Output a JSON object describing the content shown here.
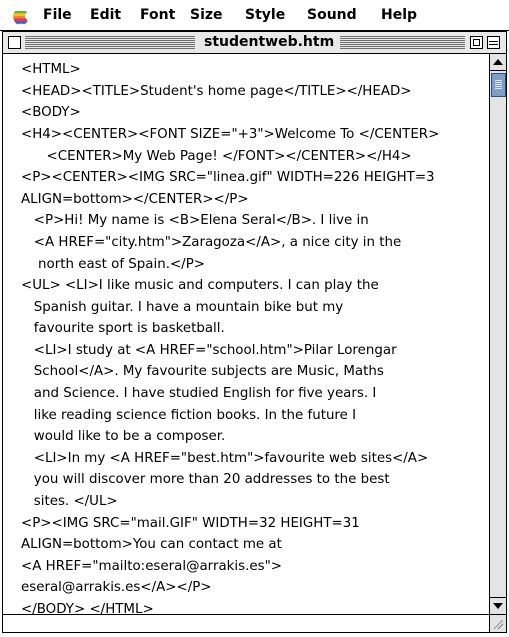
{
  "menubar": {
    "apple_icon": "apple-logo",
    "items": [
      "File",
      "Edit",
      "Font",
      "Size",
      "Style",
      "Sound",
      "Help"
    ]
  },
  "window": {
    "title": "studentweb.htm"
  },
  "document": {
    "lines": [
      "<HTML>",
      "<HEAD><TITLE>Student's home page</TITLE></HEAD>",
      "<BODY>",
      "<H4><CENTER><FONT SIZE=\"+3\">Welcome To </CENTER>",
      "      <CENTER>My Web Page! </FONT></CENTER></H4>",
      "<P><CENTER><IMG SRC=\"linea.gif\" WIDTH=226 HEIGHT=3",
      "ALIGN=bottom></CENTER></P>",
      "   <P>Hi! My name is <B>Elena Seral</B>. I live in",
      "   <A HREF=\"city.htm\">Zaragoza</A>, a nice city in the",
      "    north east of Spain.</P>",
      "<UL> <LI>I like music and computers. I can play the",
      "   Spanish guitar. I have a mountain bike but my",
      "   favourite sport is basketball.",
      "   <LI>I study at <A HREF=\"school.htm\">Pilar Lorengar",
      "   School</A>. My favourite subjects are Music, Maths",
      "   and Science. I have studied English for five years. I",
      "   like reading science fiction books. In the future I",
      "   would like to be a composer.",
      "   <LI>In my <A HREF=\"best.htm\">favourite web sites</A>",
      "   you will discover more than 20 addresses to the best",
      "   sites. </UL>",
      "<P><IMG SRC=\"mail.GIF\" WIDTH=32 HEIGHT=31",
      "ALIGN=bottom>You can contact me at",
      "<A HREF=\"mailto:eseral@arrakis.es\">",
      "eseral@arrakis.es</A></P>",
      "</BODY> </HTML>"
    ]
  },
  "scrollbar": {
    "thumb_position_fraction": 0.0
  }
}
